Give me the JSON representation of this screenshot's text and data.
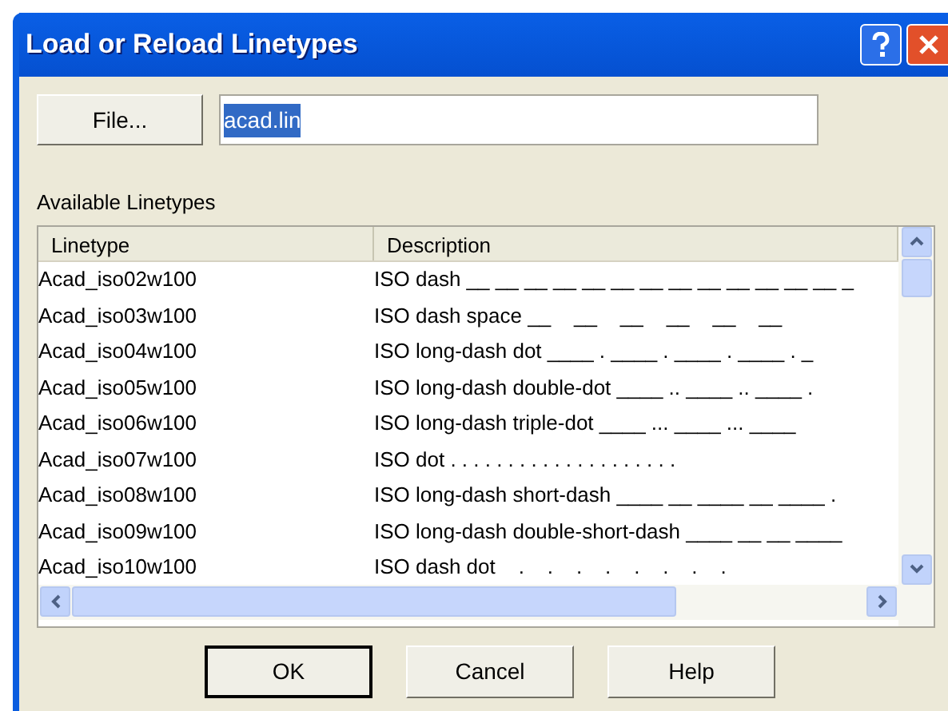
{
  "window": {
    "title": "Load or Reload Linetypes"
  },
  "file_button": "File...",
  "file_field": {
    "value": "acad.lin",
    "selected": true
  },
  "list_label": "Available Linetypes",
  "table": {
    "columns": [
      "Linetype",
      "Description"
    ],
    "rows": [
      {
        "linetype": "Acad_iso02w100",
        "description": "ISO dash __ __ __ __ __ __ __ __ __ __ __ __ __ _"
      },
      {
        "linetype": "Acad_iso03w100",
        "description": "ISO dash space __    __    __    __    __    __"
      },
      {
        "linetype": "Acad_iso04w100",
        "description": "ISO long-dash dot ____ . ____ . ____ . ____ . _"
      },
      {
        "linetype": "Acad_iso05w100",
        "description": "ISO long-dash double-dot ____ .. ____ .. ____ ."
      },
      {
        "linetype": "Acad_iso06w100",
        "description": "ISO long-dash triple-dot ____ ... ____ ... ____"
      },
      {
        "linetype": "Acad_iso07w100",
        "description": "ISO dot . . . . . . . . . . . . . . . . . . . ."
      },
      {
        "linetype": "Acad_iso08w100",
        "description": "ISO long-dash short-dash ____ __ ____ __ ____ ."
      },
      {
        "linetype": "Acad_iso09w100",
        "description": "ISO long-dash double-short-dash ____ __ __ ____"
      },
      {
        "linetype": "Acad_iso10w100",
        "description": "ISO dash dot    .    .    .    .    .    .    .    ."
      }
    ]
  },
  "buttons": [
    "OK",
    "Cancel",
    "Help"
  ]
}
